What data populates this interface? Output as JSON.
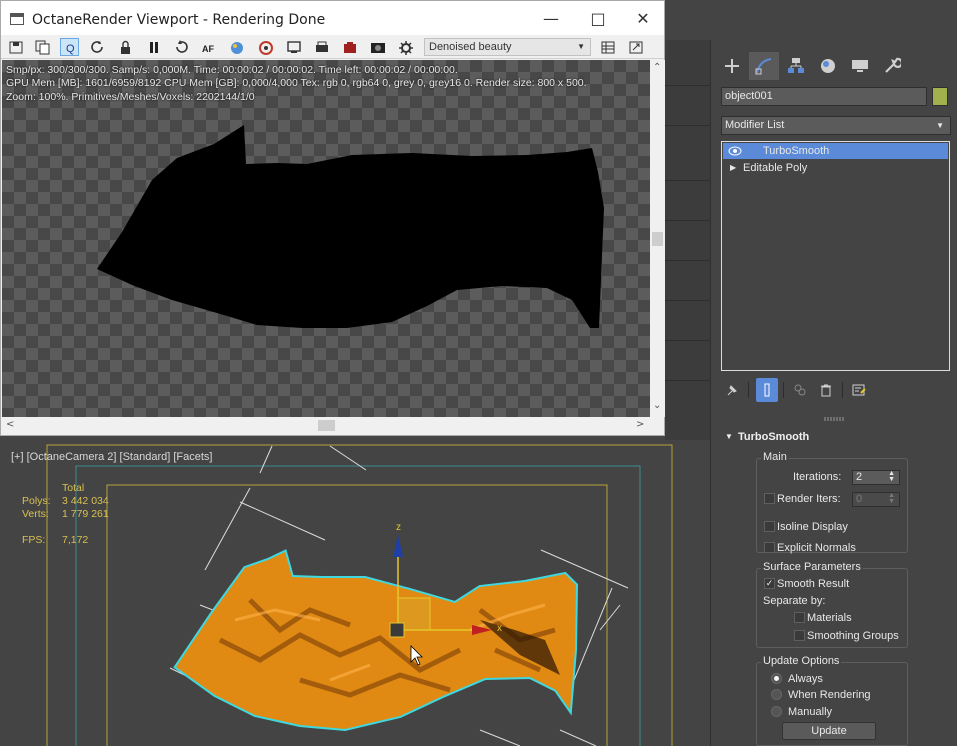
{
  "octane_window": {
    "title": "OctaneRender Viewport - Rendering Done",
    "aov_selected": "Denoised beauty",
    "stats": [
      "Smp/px: 300/300/300.   Samp/s: 0,000M.   Time: 00:00:02 / 00:00:02.   Time left: 00:00:02 / 00:00:00.",
      "GPU Mem [MB]: 1601/6959/8192   CPU Mem [GB]: 0,000/4,000   Tex: rgb 0, rgb64 0, grey 0, grey16 0.   Render size: 800 x 500.",
      "Zoom: 100%.   Primitives/Meshes/Voxels: 2202144/1/0"
    ],
    "toolbar_icons": [
      "save-icon",
      "copy-icon",
      "quick-icon",
      "refresh-icon",
      "lock-icon",
      "pause-icon",
      "restart-icon",
      "focus-icon",
      "material-picker-icon",
      "settings-icon",
      "region-icon",
      "printer-icon",
      "camera-icon",
      "snapshot-icon",
      "gear-icon"
    ],
    "toolbar_icons_right": [
      "list-icon",
      "expand-icon"
    ],
    "toolbar_active_icon": "quick-icon"
  },
  "max_viewport": {
    "label": "[+] [OctaneCamera 2] [Standard] [Facets]",
    "stats_header": "Total",
    "stats": [
      {
        "key": "Polys:",
        "value": "3 442 034"
      },
      {
        "key": "Verts:",
        "value": "1 779 261"
      }
    ],
    "fps_key": "FPS:",
    "fps_value": "7,172",
    "gizmo_axes": {
      "x": "x",
      "z": "z"
    }
  },
  "command_panel": {
    "object_name": "object001",
    "object_color": "#a3b14d",
    "modifier_list": "Modifier List",
    "stack": [
      {
        "label": "TurboSmooth",
        "selected": true
      },
      {
        "label": "Editable Poly",
        "selected": false
      }
    ],
    "rollout_title": "TurboSmooth",
    "main": {
      "group": "Main",
      "iterations_label": "Iterations:",
      "iterations_value": "2",
      "render_iters_label": "Render Iters:",
      "render_iters_value": "0",
      "isoline_label": "Isoline Display",
      "explicit_normals_label": "Explicit Normals"
    },
    "surface": {
      "group": "Surface Parameters",
      "smooth_result_label": "Smooth Result",
      "separate_by_label": "Separate by:",
      "materials_label": "Materials",
      "smoothing_groups_label": "Smoothing Groups"
    },
    "update": {
      "group": "Update Options",
      "always_label": "Always",
      "when_rendering_label": "When Rendering",
      "manually_label": "Manually",
      "update_button": "Update"
    }
  },
  "colors": {
    "selection_blue": "#5b8ad8",
    "stats_yellow": "#d8c050",
    "object_orange": "#e08a14",
    "outline_cyan": "#3fd8e0"
  }
}
